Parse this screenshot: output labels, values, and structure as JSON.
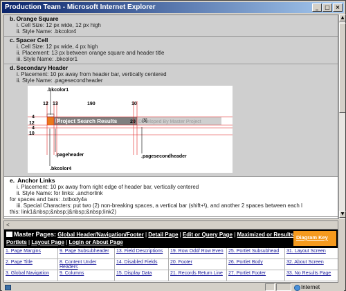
{
  "window": {
    "title": "Production Team - Microsoft Internet Explorer"
  },
  "doc": {
    "sections": [
      {
        "num": "b.",
        "title": "Orange Square",
        "lines": [
          "i. Cell Size: 12 px wide, 12 px high",
          "ii. Style Name: .bkcolor4"
        ]
      },
      {
        "num": "c.",
        "title": "Spacer Cell",
        "lines": [
          "i. Cell Size: 12 px wide, 4 px high",
          "ii. Placement: 13 px between orange square and header title",
          "iii. Style Name: .bkcolor1"
        ]
      },
      {
        "num": "d.",
        "title": "Secondary Header",
        "lines": [
          "i. Placement: 10 px away from header bar, vertically centered",
          "ii. Style Name: .pagesecondheader"
        ]
      }
    ],
    "diagram": {
      "top_label": ".bkcolor1",
      "dims_top": [
        "12",
        "13",
        "190",
        "10"
      ],
      "dims_left": [
        "4",
        "12",
        "4",
        "10"
      ],
      "header_text": "Project Search Results",
      "num_20": "20",
      "secondary_text": "Developed By Master Project",
      "bracket_text": "[$]",
      "label_pageheader": ".pageheader",
      "label_pagesecondheader": ".pagesecondheader",
      "label_bkcolor4": ".bkcolor4",
      "colors": {
        "header_bar": "#7f7f7f",
        "orange": "#e87a1e",
        "redline": "#e02020"
      }
    },
    "anchor": {
      "num": "e.",
      "title": "Anchor Links",
      "lines": [
        "i. Placement: 10 px away from right edge of header bar, vertically centered",
        "ii. Style Name: for links: .anchorlink",
        "for spaces and bars: .txtbody4a",
        "iii. Special Characters: put two (2) non-breaking spaces, a vertical bar (shift+\\), and another 2 spaces between each l",
        "this: link1&nbsp;&nbsp;|&nbsp;&nbsp;link2)"
      ]
    }
  },
  "lower": {
    "arrow": "<",
    "master_label": "Master Pages:",
    "links": [
      "Global Header/Navigation/Footer",
      "Detail Page",
      "Edit or Query Page",
      "Maximized or Results Page",
      "Portlets",
      "Layout Page",
      "Login or About Page"
    ],
    "diagram_key": "Diagram Key",
    "grid": [
      "1. Page Margins",
      "9. Page Subsubheader",
      "13. Field Descriptions",
      "19. Row Odd/ Row Even",
      "25. Portlet Subsubhead",
      "31. Layout Screen",
      "2. Page Title",
      "8. Content Under Headers",
      "14. Disabled Fields",
      "20. Footer",
      "26. Portlet Body",
      "32. About Screen",
      "3. Global Navigation",
      "9. Columns",
      "15. Display Data",
      "21. Records Return Line",
      "27. Portlet Footer",
      "33. No Results Page"
    ]
  },
  "statusbar": {
    "zone": "Internet"
  }
}
